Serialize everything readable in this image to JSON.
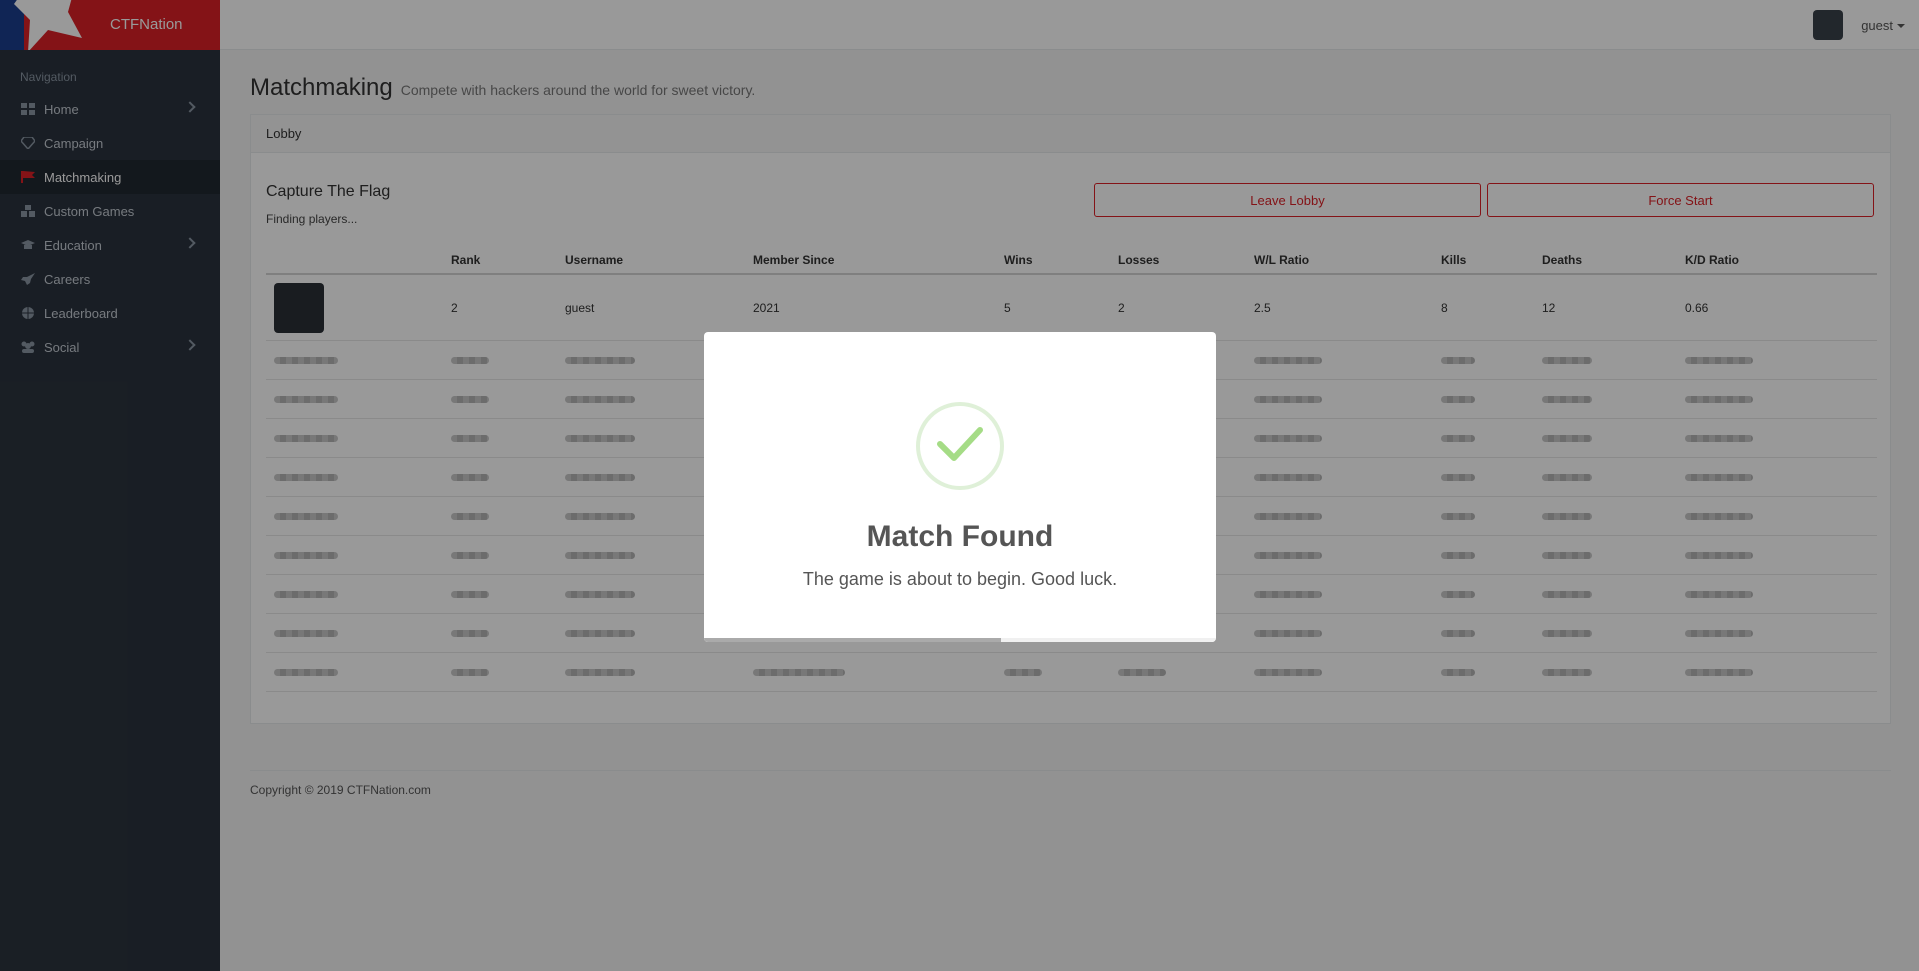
{
  "brand": {
    "name": "CTFNation"
  },
  "sidebar": {
    "header": "Navigation",
    "items": [
      {
        "label": "Home",
        "icon": "grid-icon"
      },
      {
        "label": "Campaign",
        "icon": "diamond-icon"
      },
      {
        "label": "Matchmaking",
        "icon": "flag-icon"
      },
      {
        "label": "Custom Games",
        "icon": "cubes-icon"
      },
      {
        "label": "Education",
        "icon": "graduation-cap-icon"
      },
      {
        "label": "Careers",
        "icon": "rocket-icon"
      },
      {
        "label": "Leaderboard",
        "icon": "globe-icon"
      },
      {
        "label": "Social",
        "icon": "users-icon"
      }
    ]
  },
  "topbar": {
    "user": "guest"
  },
  "page": {
    "title": "Matchmaking",
    "subtitle": "Compete with hackers around the world for sweet victory."
  },
  "lobby": {
    "panel_title": "Lobby",
    "game_title": "Capture The Flag",
    "status": "Finding players...",
    "leave_label": "Leave Lobby",
    "force_label": "Force Start"
  },
  "table": {
    "headers": [
      "Rank",
      "Username",
      "Member Since",
      "Wins",
      "Losses",
      "W/L Ratio",
      "Kills",
      "Deaths",
      "K/D Ratio"
    ],
    "player": {
      "rank": "2",
      "username": "guest",
      "member_since": "2021",
      "wins": "5",
      "losses": "2",
      "wl_ratio": "2.5",
      "kills": "8",
      "deaths": "12",
      "kd_ratio": "0.66"
    }
  },
  "footer": {
    "text": "Copyright © 2019 CTFNation.com"
  },
  "modal": {
    "title": "Match Found",
    "text": "The game is about to begin. Good luck.",
    "timer_progress": 0.58
  },
  "colors": {
    "accent": "#dc2127",
    "sidebar": "#2b333e",
    "success": "#a5dc86"
  }
}
